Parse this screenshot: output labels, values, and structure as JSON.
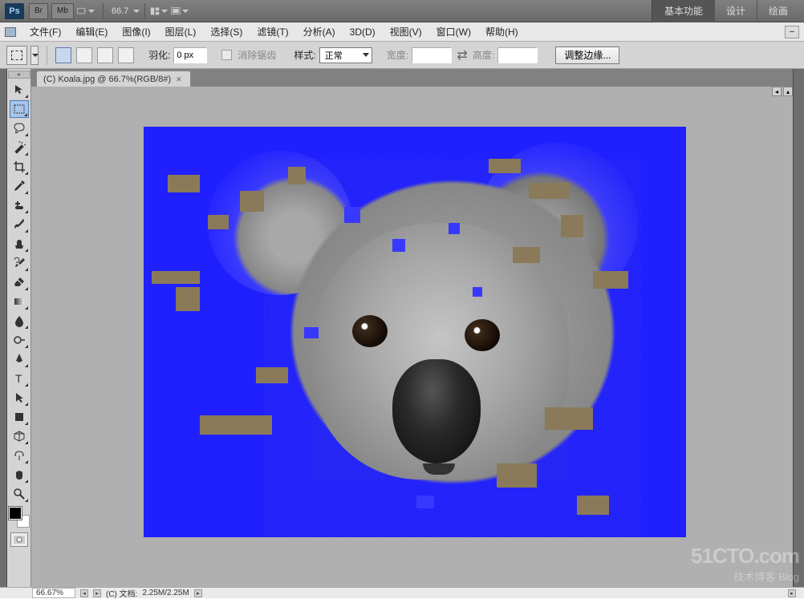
{
  "topbar": {
    "logo": "Ps",
    "br": "Br",
    "mb": "Mb",
    "zoom": "66.7",
    "tabs": {
      "basic": "基本功能",
      "design": "设计",
      "paint": "绘画"
    }
  },
  "menus": {
    "file": "文件(F)",
    "edit": "编辑(E)",
    "image": "图像(I)",
    "layer": "图层(L)",
    "select": "选择(S)",
    "filter": "滤镜(T)",
    "analysis": "分析(A)",
    "threed": "3D(D)",
    "view": "视图(V)",
    "window": "窗口(W)",
    "help": "帮助(H)"
  },
  "options": {
    "feather_label": "羽化:",
    "feather_value": "0 px",
    "antialias": "消除锯齿",
    "style_label": "样式:",
    "style_value": "正常",
    "width_label": "宽度:",
    "width_value": "",
    "height_label": "高度:",
    "height_value": "",
    "refine": "调整边缘..."
  },
  "doc": {
    "tab_title": "(C) Koala.jpg @ 66.7%(RGB/8#)"
  },
  "status": {
    "zoom": "66.67%",
    "doc_label": "(C) 文档:",
    "doc_size": "2.25M/2.25M"
  },
  "watermark": {
    "l1": "51CTO.com",
    "l2": "技术博客  Blog"
  }
}
